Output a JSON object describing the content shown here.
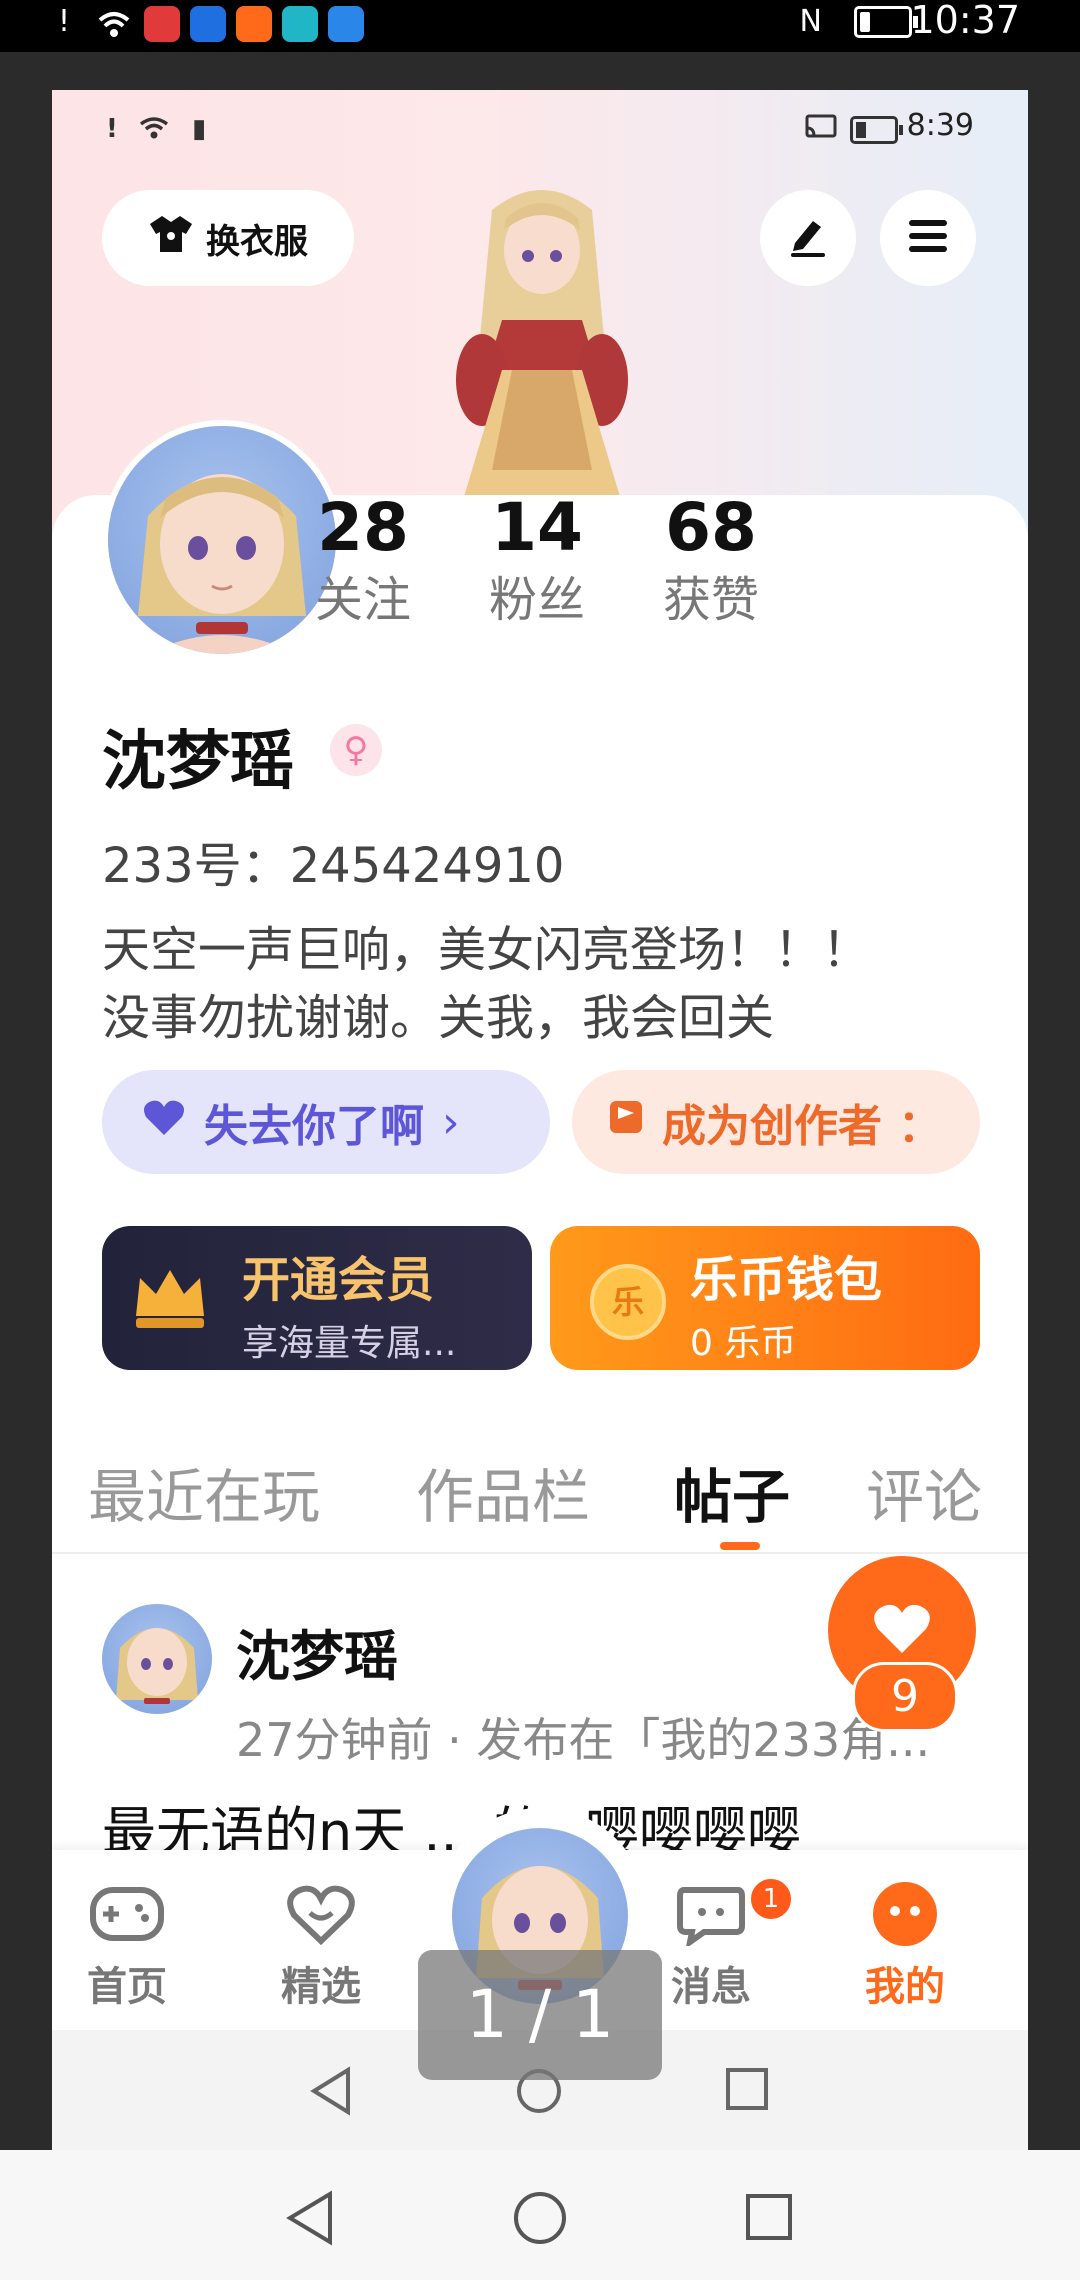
{
  "outer_status": {
    "time": "10:37",
    "nfc": "N"
  },
  "inner_status": {
    "time": "8:39"
  },
  "header": {
    "outfit_label": "换衣服"
  },
  "stats": [
    {
      "value": "28",
      "label": "关注"
    },
    {
      "value": "14",
      "label": "粉丝"
    },
    {
      "value": "68",
      "label": "获赞"
    }
  ],
  "profile": {
    "name": "沈梦瑶",
    "gender_symbol": "♀",
    "id_text": "233号：245424910",
    "bio_line1": "天空一声巨响，美女闪亮登场！！！",
    "bio_line2": "没事勿扰谢谢。关我，我会回关"
  },
  "pills": {
    "lost_label": "失去你了啊",
    "lost_chevron": "›",
    "creator_label": "成为创作者",
    "creator_more": "："
  },
  "cards": {
    "vip_title": "开通会员",
    "vip_sub": "享海量专属...",
    "wallet_title": "乐币钱包",
    "wallet_sub": "0 乐币",
    "wallet_coin": "乐"
  },
  "tabs": [
    "最近在玩",
    "作品栏",
    "帖子",
    "评论"
  ],
  "post": {
    "author": "沈梦瑶",
    "meta": "27分钟前 · 发布在「我的233角...",
    "text": "最无语的n天 ... 的! 嘤嘤嘤嘤",
    "like_count": "9"
  },
  "nav": {
    "home": "首页",
    "featured": "精选",
    "messages": "消息",
    "mine": "我的",
    "message_badge": "1"
  },
  "viewer": {
    "counter": "1 / 1"
  },
  "colors": {
    "accent": "#ff6a1a",
    "purple": "#5d57d8",
    "vip_bg": "#22233a"
  }
}
